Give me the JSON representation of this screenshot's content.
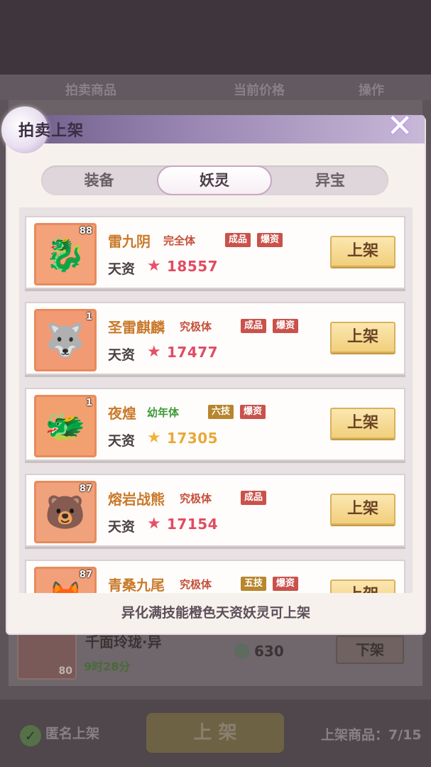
{
  "background": {
    "header": {
      "col1": "拍卖商品",
      "col2": "当前价格",
      "col3": "操作"
    },
    "row": {
      "name": "千面玲珑·异",
      "time": "9时28分",
      "level": "80",
      "price": "630",
      "button": "下架"
    },
    "footer": {
      "anonymous_label": "匿名上架",
      "list_button": "上 架",
      "count": "上架商品：7/15"
    }
  },
  "modal": {
    "title": "拍卖上架",
    "close_glyph": "✕",
    "tabs": [
      {
        "label": "装备",
        "active": false
      },
      {
        "label": "妖灵",
        "active": true
      },
      {
        "label": "异宝",
        "active": false
      }
    ],
    "stat_label": "天资",
    "list_button": "上架",
    "items": [
      {
        "name": "雷九阴",
        "form": "完全体",
        "form_color": "red",
        "tags": [
          "成品",
          "爆资"
        ],
        "level": "88",
        "aptitude": "18557",
        "star": "red",
        "icon": "dragon-icon"
      },
      {
        "name": "圣雷麒麟",
        "form": "究极体",
        "form_color": "red",
        "tags": [
          "成品",
          "爆资"
        ],
        "level": "1",
        "aptitude": "17477",
        "star": "red",
        "icon": "qilin-icon"
      },
      {
        "name": "夜煌",
        "form": "幼年体",
        "form_color": "green",
        "tags": [
          "六技",
          "爆资"
        ],
        "level": "1",
        "aptitude": "17305",
        "star": "gold",
        "icon": "fire-dragon-icon"
      },
      {
        "name": "熔岩战熊",
        "form": "究极体",
        "form_color": "red",
        "tags": [
          "成品"
        ],
        "level": "87",
        "aptitude": "17154",
        "star": "red",
        "icon": "bear-icon"
      },
      {
        "name": "青桑九尾",
        "form": "究极体",
        "form_color": "red",
        "tags": [
          "五技",
          "爆资"
        ],
        "level": "87",
        "aptitude": "",
        "star": "red",
        "icon": "fox-icon"
      }
    ],
    "footer_note": "异化满技能橙色天资妖灵可上架"
  }
}
